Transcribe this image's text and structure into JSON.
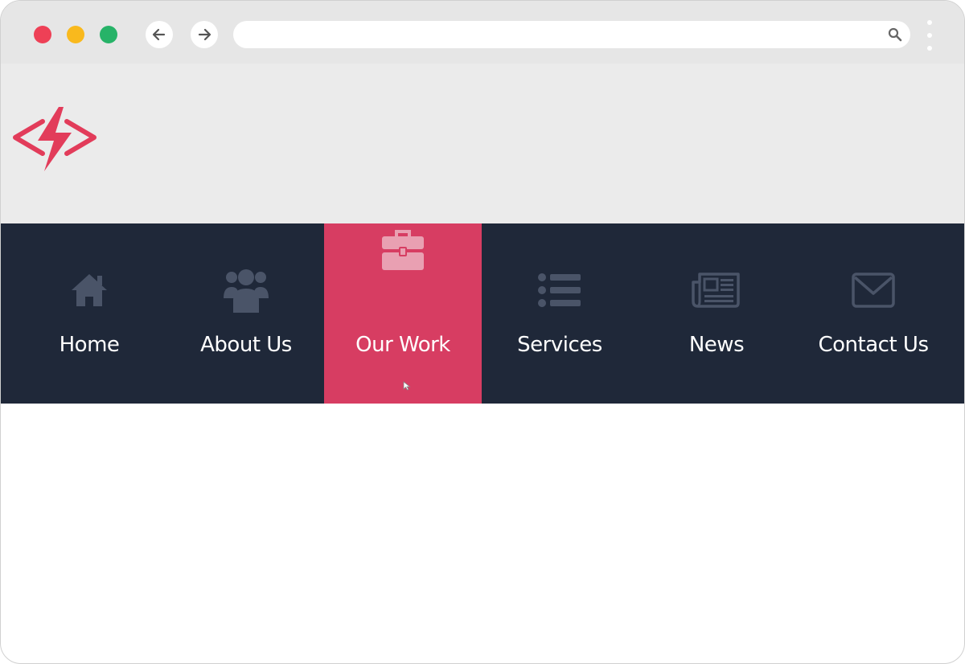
{
  "browser": {
    "url": "",
    "url_placeholder": ""
  },
  "colors": {
    "accent": "#d73d62",
    "navbar_bg": "#1f2839",
    "header_bg": "#ebebeb",
    "icon_muted": "#4a5468"
  },
  "logo": {
    "icon": "lightning-code-logo"
  },
  "nav": {
    "items": [
      {
        "label": "Home",
        "icon": "home-icon",
        "active": false
      },
      {
        "label": "About Us",
        "icon": "users-icon",
        "active": false
      },
      {
        "label": "Our Work",
        "icon": "briefcase-icon",
        "active": true
      },
      {
        "label": "Services",
        "icon": "list-icon",
        "active": false
      },
      {
        "label": "News",
        "icon": "newspaper-icon",
        "active": false
      },
      {
        "label": "Contact Us",
        "icon": "envelope-icon",
        "active": false
      }
    ]
  }
}
